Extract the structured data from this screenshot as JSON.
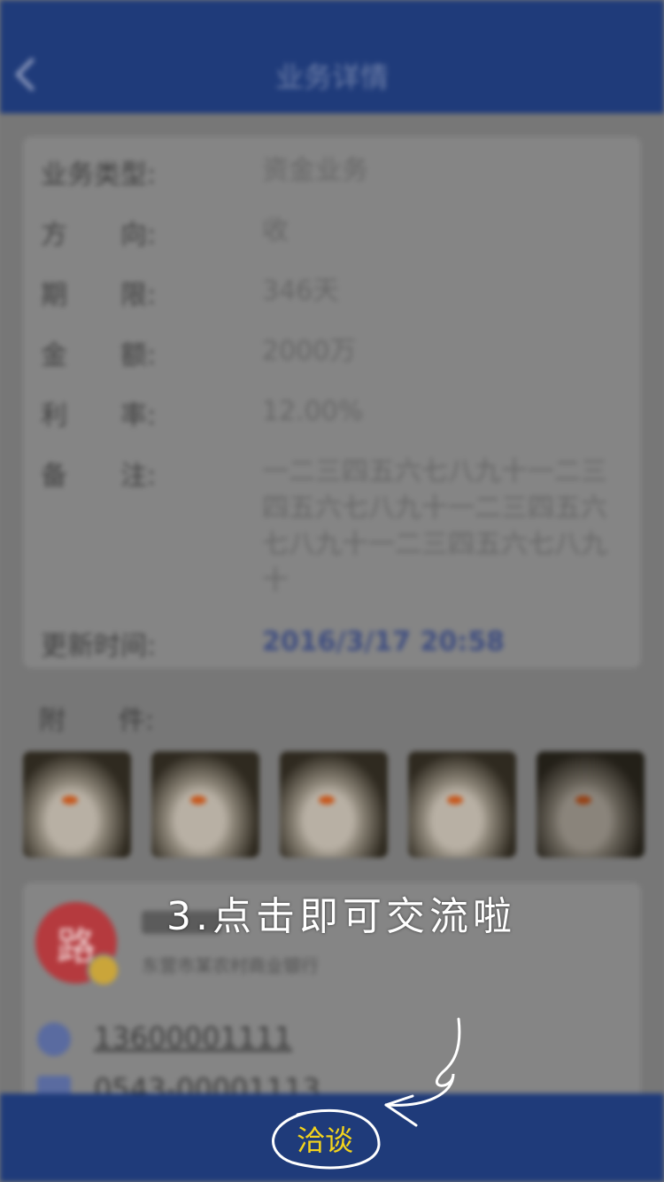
{
  "header": {
    "title": "业务详情"
  },
  "details": [
    {
      "label": "业务类型:",
      "value": "资金业务"
    },
    {
      "label": "方　　向:",
      "value": "收"
    },
    {
      "label": "期　　限:",
      "value": "346天"
    },
    {
      "label": "金　　额:",
      "value": "2000万"
    },
    {
      "label": "利　　率:",
      "value": "12.00%"
    },
    {
      "label": "备　　注:",
      "value": "一二三四五六七八九十一二三四五六七八九十一二三四五六七八九十一二三四五六七八九十"
    },
    {
      "label": "更新时间:",
      "value": "2016/3/17 20:58"
    }
  ],
  "attachments": {
    "label": "附　　件:",
    "count": 5
  },
  "contact": {
    "avatar_char": "路",
    "org": "东营市某农村商业银行",
    "phone": "13600001111",
    "phone2": "0543-00001113"
  },
  "tip": "3.点击即可交流啦",
  "action": {
    "chat_label": "洽谈"
  },
  "colors": {
    "bar": "#1f3b7a",
    "accent": "#f3d31c"
  }
}
